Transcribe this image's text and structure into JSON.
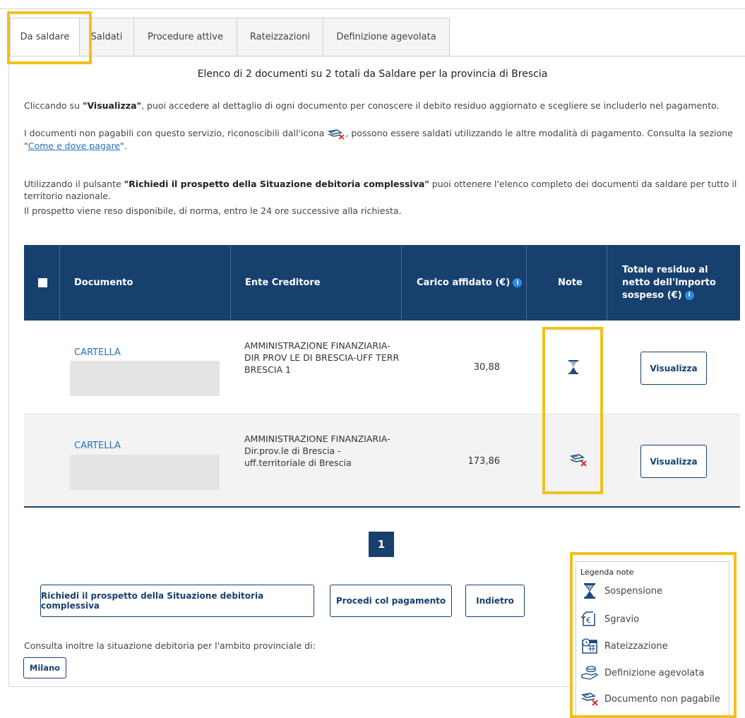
{
  "tabs": [
    {
      "label": "Da saldare",
      "active": true
    },
    {
      "label": "Saldati"
    },
    {
      "label": "Procedure attive"
    },
    {
      "label": "Rateizzazioni"
    },
    {
      "label": "Definizione agevolata"
    }
  ],
  "title": "Elenco di 2 documenti su 2 totali da Saldare per la provincia di Brescia",
  "intro": {
    "p1_a": "Cliccando su ",
    "p1_b": "\"Visualizza\"",
    "p1_c": ", puoi accedere al dettaglio di ogni documento per conoscere il debito residuo aggiornato e scegliere se includerlo nel pagamento.",
    "p2_a": "I documenti non pagabili con questo servizio, riconoscibili dall'icona ",
    "p2_b": ", possono essere saldati utilizzando le altre modalità di pagamento. Consulta la sezione \"",
    "p2_link": "Come e dove pagare",
    "p2_c": "\".",
    "p3_a": "Utilizzando il pulsante ",
    "p3_b": "\"Richiedi il prospetto della Situazione debitoria complessiva\"",
    "p3_c": " puoi ottenere l'elenco completo dei documenti da saldare per tutto il territorio nazionale.",
    "p4": "Il prospetto viene reso disponibile, di norma, entro le 24 ore successive alla richiesta."
  },
  "table": {
    "headers": {
      "documento": "Documento",
      "ente": "Ente Creditore",
      "carico": "Carico affidato (€)",
      "note": "Note",
      "totale": "Totale residuo al netto dell'importo sospeso (€)"
    },
    "rows": [
      {
        "doc_type": "CARTELLA",
        "ente": "AMMINISTRAZIONE FINANZIARIA- DIR PROV LE DI BRESCIA-UFF TERR BRESCIA 1",
        "amount": "30,88",
        "note_icon": "hourglass-icon",
        "action": "Visualizza"
      },
      {
        "doc_type": "CARTELLA",
        "ente": "AMMINISTRAZIONE FINANZIARIA- Dir.prov.le di Brescia - uff.territoriale di Brescia",
        "amount": "173,86",
        "note_icon": "not-payable-icon",
        "action": "Visualizza"
      }
    ]
  },
  "pagination": {
    "current": "1"
  },
  "buttons": {
    "prospetto": "Richiedi il prospetto della Situazione debitoria complessiva",
    "pagamento": "Procedi col pagamento",
    "indietro": "Indietro"
  },
  "consult": {
    "text": "Consulta inoltre la situazione debitoria per l'ambito provinciale di:",
    "province": "Milano"
  },
  "legend": {
    "title": "Legenda note",
    "items": [
      {
        "label": "Sospensione",
        "icon": "hourglass-icon"
      },
      {
        "label": "Sgravio",
        "icon": "euro-return-icon"
      },
      {
        "label": "Rateizzazione",
        "icon": "calendar-icon"
      },
      {
        "label": "Definizione agevolata",
        "icon": "hand-coins-icon"
      },
      {
        "label": "Documento non pagabile",
        "icon": "not-payable-icon"
      }
    ]
  },
  "colors": {
    "primary": "#17406f",
    "link": "#2570c4",
    "highlight": "#f4bf1b"
  }
}
